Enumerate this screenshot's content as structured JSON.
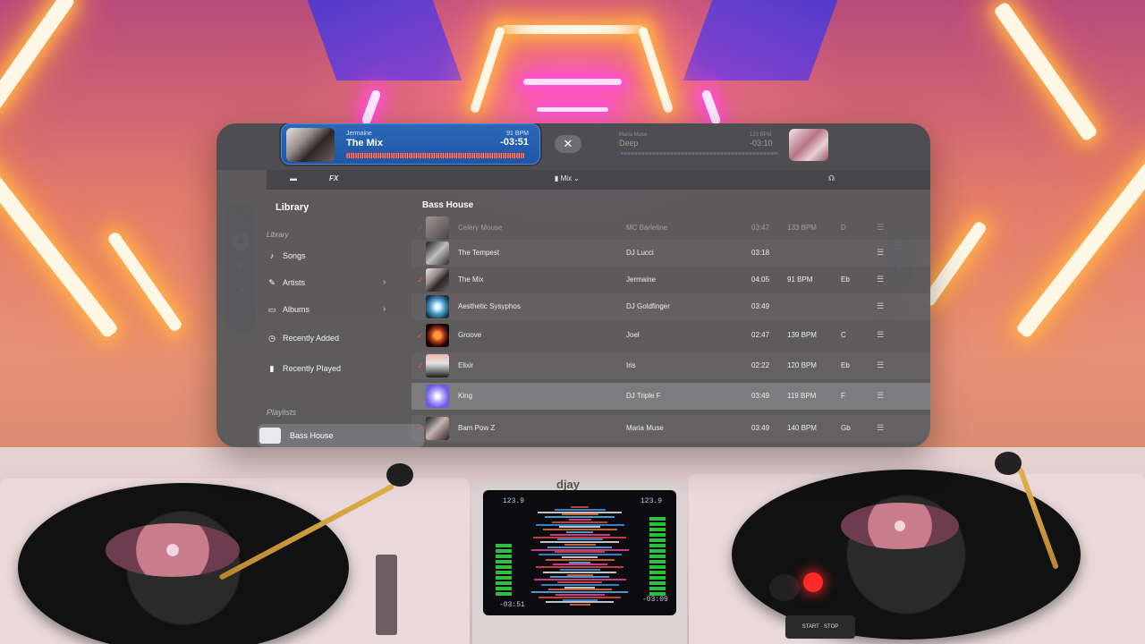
{
  "colors": {
    "accent_blue": "#1f56a6",
    "check_red": "#ff4a64",
    "panel": "#58585c"
  },
  "now_playing": {
    "artist": "Jermaine",
    "title": "The Mix",
    "bpm": "91 BPM",
    "time": "-03:51"
  },
  "close_icon": "✕",
  "deck_b": {
    "artist": "Maria Muse",
    "title": "Deep",
    "bpm": "123 BPM",
    "time": "-03:10"
  },
  "toolbar": {
    "library_icon": "library-icon",
    "fx_label": "FX",
    "mix_label": "Mix",
    "headphones_icon": "headphones-icon"
  },
  "sidebar": {
    "title": "Library",
    "section_library": "Library",
    "items": [
      {
        "label": "Songs",
        "icon": "♪"
      },
      {
        "label": "Artists",
        "icon": "✎"
      },
      {
        "label": "Albums",
        "icon": "▭"
      },
      {
        "label": "Recently Added",
        "icon": "◷"
      },
      {
        "label": "Recently Played",
        "icon": "▮"
      }
    ],
    "section_playlists": "Playlists",
    "selected_playlist": "Bass House"
  },
  "main": {
    "title": "Bass House",
    "rows": [
      {
        "title": "Celery Mouse",
        "artist": "MC Barletine",
        "time": "03:47",
        "bpm": "133 BPM",
        "key": "D",
        "checked": true
      },
      {
        "title": "The Tempest",
        "artist": "DJ Lucci",
        "time": "03:18",
        "bpm": "",
        "key": "",
        "checked": false
      },
      {
        "title": "The Mix",
        "artist": "Jermaine",
        "time": "04:05",
        "bpm": "91 BPM",
        "key": "Eb",
        "checked": true
      },
      {
        "title": "Aesthetic Sysyphos",
        "artist": "DJ Goldfinger",
        "time": "03:49",
        "bpm": "",
        "key": "",
        "checked": false
      },
      {
        "title": "Groove",
        "artist": "Joel",
        "time": "02:47",
        "bpm": "139 BPM",
        "key": "C",
        "checked": true
      },
      {
        "title": "Elixir",
        "artist": "Iris",
        "time": "02:22",
        "bpm": "120 BPM",
        "key": "Eb",
        "checked": true
      },
      {
        "title": "King",
        "artist": "DJ Triple F",
        "time": "03:49",
        "bpm": "119 BPM",
        "key": "F",
        "checked": true
      },
      {
        "title": "Bam Pow Z",
        "artist": "Maria Muse",
        "time": "03:49",
        "bpm": "140 BPM",
        "key": "Gb",
        "checked": true
      }
    ]
  },
  "left_pill": [
    "music-icon",
    "bag-icon",
    "play-icon",
    "trend-icon",
    "search-icon"
  ],
  "right_pill": [
    "list-icon",
    "record-icon"
  ],
  "mixer": {
    "brand": "djay",
    "left_bpm": "123.9",
    "right_bpm": "123.9",
    "left_time": "-03:51",
    "right_time": "-03:09",
    "start_stop": "START · STOP"
  }
}
